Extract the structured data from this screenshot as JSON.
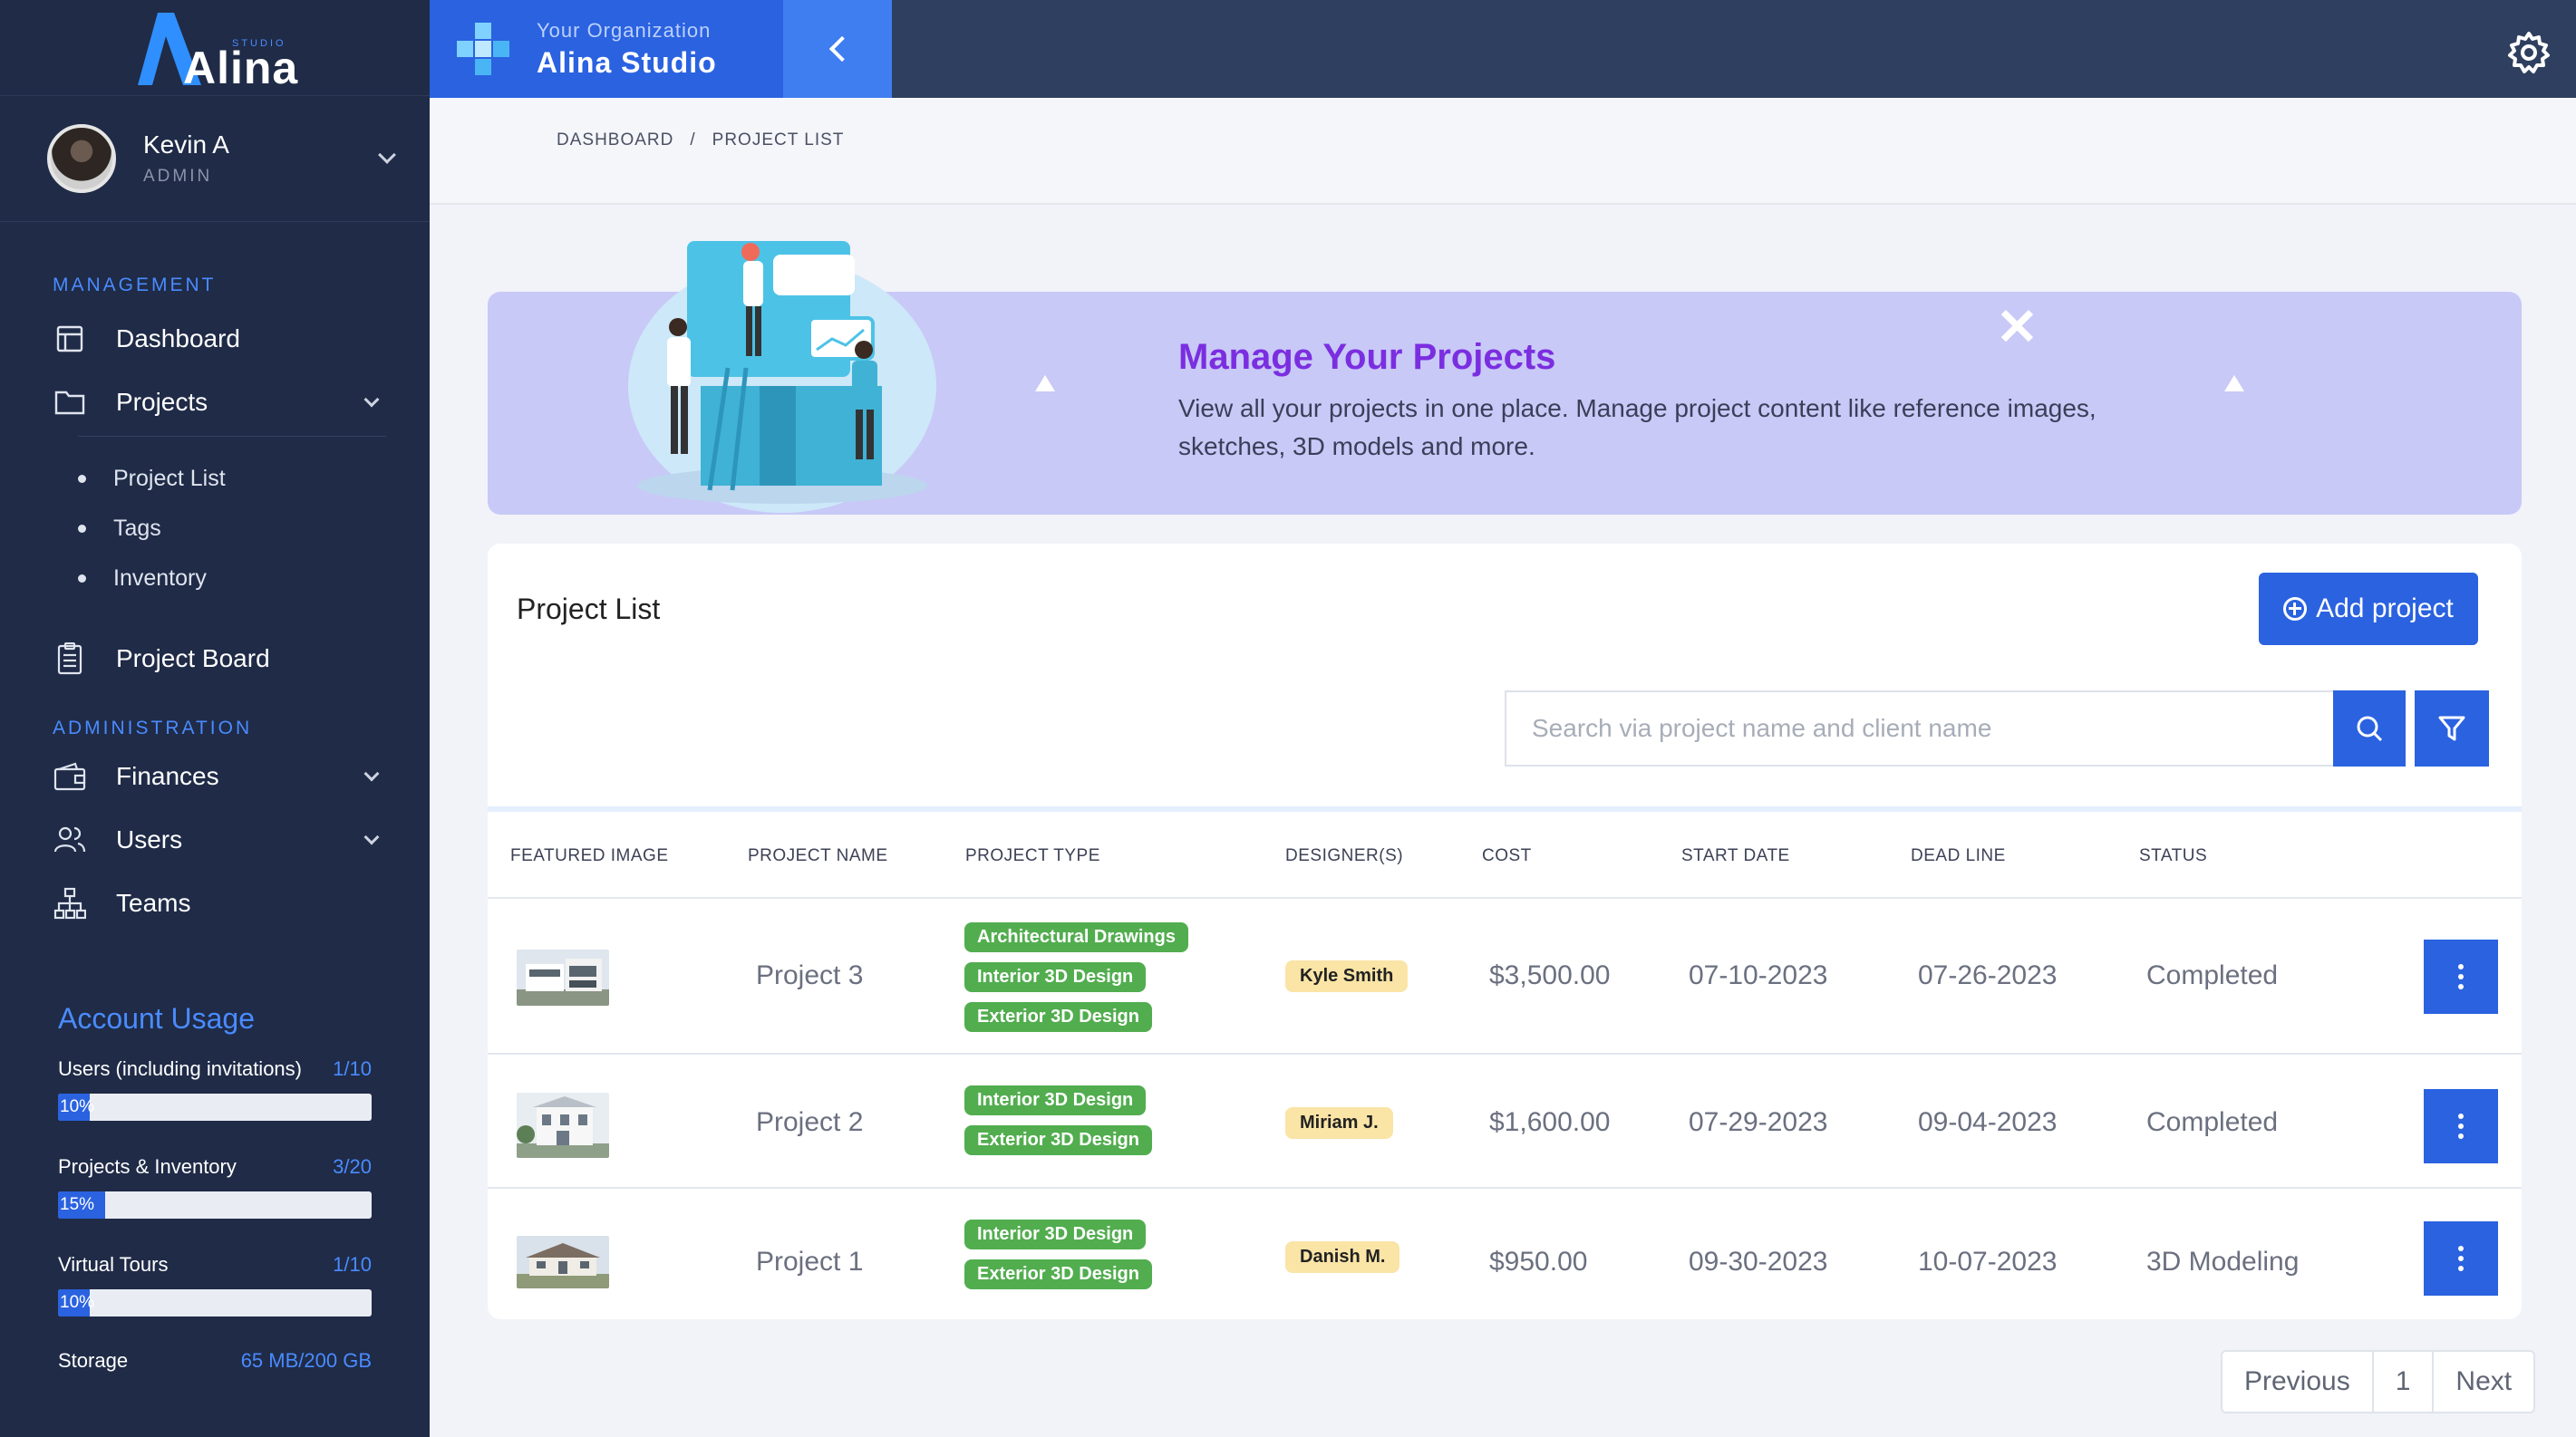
{
  "brand": {
    "name": "Alina",
    "sub": "STUDIO"
  },
  "user": {
    "name": "Kevin A",
    "role": "ADMIN"
  },
  "sidebar": {
    "management_title": "MANAGEMENT",
    "admin_title": "ADMINISTRATION",
    "items": [
      {
        "label": "Dashboard",
        "icon": "dashboard-icon"
      },
      {
        "label": "Projects",
        "icon": "folder-icon",
        "expanded": true
      },
      {
        "label": "Project Board",
        "icon": "clipboard-icon"
      },
      {
        "label": "Finances",
        "icon": "wallet-icon"
      },
      {
        "label": "Users",
        "icon": "users-icon"
      },
      {
        "label": "Teams",
        "icon": "hierarchy-icon"
      }
    ],
    "sub_items": [
      "Project List",
      "Tags",
      "Inventory"
    ]
  },
  "usage": {
    "title": "Account Usage",
    "rows": [
      {
        "label": "Users (including invitations)",
        "count": "1/10",
        "percent_label": "10%",
        "fill": 0.1
      },
      {
        "label": "Projects & Inventory",
        "count": "3/20",
        "percent_label": "15%",
        "fill": 0.15
      },
      {
        "label": "Virtual Tours",
        "count": "1/10",
        "percent_label": "10%",
        "fill": 0.1
      },
      {
        "label": "Storage",
        "count": "65 MB/200 GB"
      }
    ]
  },
  "topbar": {
    "org_small": "Your Organization",
    "org_name": "Alina Studio"
  },
  "breadcrumb": {
    "root": "DASHBOARD",
    "separator": "/",
    "current": "PROJECT LIST"
  },
  "banner": {
    "title": "Manage Your Projects",
    "description": "View all your projects in one place. Manage project content like reference images, sketches, 3D models and more."
  },
  "projects": {
    "title": "Project List",
    "add_label": "Add project",
    "search_placeholder": "Search via project name and client name",
    "columns": [
      "FEATURED IMAGE",
      "PROJECT NAME",
      "PROJECT TYPE",
      "DESIGNER(S)",
      "COST",
      "START DATE",
      "DEAD LINE",
      "STATUS"
    ],
    "rows": [
      {
        "name": "Project 3",
        "types": [
          "Architectural Drawings",
          "Interior 3D Design",
          "Exterior 3D Design"
        ],
        "designer": "Kyle Smith",
        "cost": "$3,500.00",
        "start": "07-10-2023",
        "deadline": "07-26-2023",
        "status": "Completed"
      },
      {
        "name": "Project 2",
        "types": [
          "Interior 3D Design",
          "Exterior 3D Design"
        ],
        "designer": "Miriam J.",
        "cost": "$1,600.00",
        "start": "07-29-2023",
        "deadline": "09-04-2023",
        "status": "Completed"
      },
      {
        "name": "Project 1",
        "types": [
          "Interior 3D Design",
          "Exterior 3D Design"
        ],
        "designer": "Danish M.",
        "cost": "$950.00",
        "start": "09-30-2023",
        "deadline": "10-07-2023",
        "status": "3D Modeling"
      }
    ]
  },
  "pagination": {
    "prev": "Previous",
    "page": "1",
    "next": "Next"
  },
  "colors": {
    "sidebar": "#1f2b47",
    "accent": "#2a62e0",
    "tag": "#52ad4f",
    "designer": "#fae4a6",
    "banner": "#c8c9f7",
    "banner_title": "#7b2ee0"
  }
}
